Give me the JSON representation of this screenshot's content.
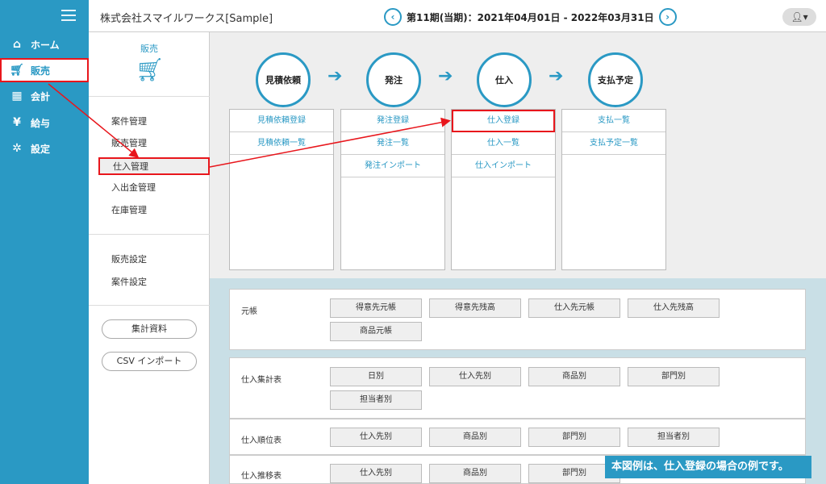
{
  "nav": {
    "items": [
      {
        "label": "ホーム",
        "icon": "home-icon"
      },
      {
        "label": "販売",
        "icon": "cart-icon"
      },
      {
        "label": "会計",
        "icon": "calculator-icon"
      },
      {
        "label": "給与",
        "icon": "money-bag-icon"
      },
      {
        "label": "設定",
        "icon": "gear-icon"
      }
    ]
  },
  "header": {
    "company": "株式会社スマイルワークス[Sample]",
    "period": "第11期(当期)：2021年04月01日 - 2022年03月31日",
    "prev": "‹",
    "next": "›"
  },
  "sub": {
    "title": "販売",
    "items": [
      "案件管理",
      "販売管理",
      "仕入管理",
      "入出金管理",
      "在庫管理"
    ],
    "settings": [
      "販売設定",
      "案件設定"
    ],
    "buttons": [
      "集計資料",
      "CSV インポート"
    ]
  },
  "flow": {
    "steps": [
      "見積依頼",
      "発注",
      "仕入",
      "支払予定"
    ],
    "columns": [
      [
        "見積依頼登録",
        "見積依頼一覧"
      ],
      [
        "発注登録",
        "発注一覧",
        "発注インポート"
      ],
      [
        "仕入登録",
        "仕入一覧",
        "仕入インポート"
      ],
      [
        "支払一覧",
        "支払予定一覧"
      ]
    ]
  },
  "reports": [
    {
      "label": "元帳",
      "buttons": [
        "得意先元帳",
        "得意先残高",
        "仕入先元帳",
        "仕入先残高",
        "商品元帳"
      ]
    },
    {
      "label": "仕入集計表",
      "buttons": [
        "日別",
        "仕入先別",
        "商品別",
        "部門別",
        "担当者別"
      ]
    },
    {
      "label": "仕入順位表",
      "buttons": [
        "仕入先別",
        "商品別",
        "部門別",
        "担当者別"
      ]
    },
    {
      "label": "仕入推移表",
      "buttons": [
        "仕入先別",
        "商品別",
        "部門別"
      ]
    }
  ],
  "note": "本図例は、仕入登録の場合の例です。",
  "colors": {
    "accent": "#2a99c4",
    "highlight": "#e8161c"
  }
}
